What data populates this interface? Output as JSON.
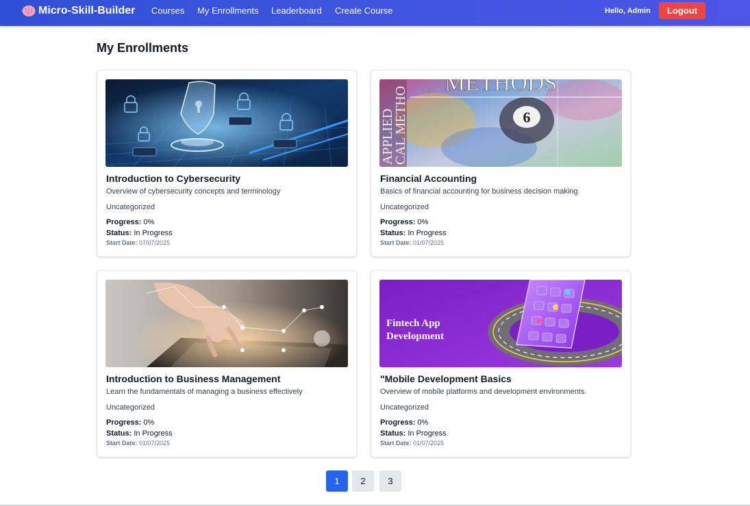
{
  "nav": {
    "brand": "Micro-Skill-Builder",
    "links": [
      "Courses",
      "My Enrollments",
      "Leaderboard",
      "Create Course"
    ],
    "greeting": "Hello, Admin",
    "logout": "Logout"
  },
  "page": {
    "title": "My Enrollments"
  },
  "labels": {
    "progress": "Progress:",
    "status": "Status:",
    "start_date": "Start Date:"
  },
  "cards": [
    {
      "title": "Introduction to Cybersecurity",
      "description": "Overview of cybersecurity concepts and terminology",
      "category": "Uncategorized",
      "progress": "0%",
      "status": "In Progress",
      "start_date": "07/07/2025"
    },
    {
      "title": "Financial Accounting",
      "description": "Basics of financial accounting for business decision making",
      "category": "Uncategorized",
      "progress": "0%",
      "status": "In Progress",
      "start_date": "01/07/2025",
      "image_text": {
        "big": "METHODS",
        "side1": "APPLIED",
        "side2": "CAL METHO"
      }
    },
    {
      "title": "Introduction to Business Management",
      "description": "Learn the fundamentals of managing a business effectively",
      "category": "Uncategorized",
      "progress": "0%",
      "status": "In Progress",
      "start_date": "01/07/2025"
    },
    {
      "title": "\"Mobile Development Basics",
      "description": "Overview of mobile platforms and development environments.",
      "category": "Uncategorized",
      "progress": "0%",
      "status": "In Progress",
      "start_date": "01/07/2025",
      "image_text": {
        "line1": "Fintech App",
        "line2": "Development"
      }
    }
  ],
  "pagination": {
    "pages": [
      "1",
      "2",
      "3"
    ],
    "current": "1"
  },
  "colors": {
    "nav": "#3f55df",
    "logout": "#ef4444",
    "active_page": "#2563eb"
  }
}
